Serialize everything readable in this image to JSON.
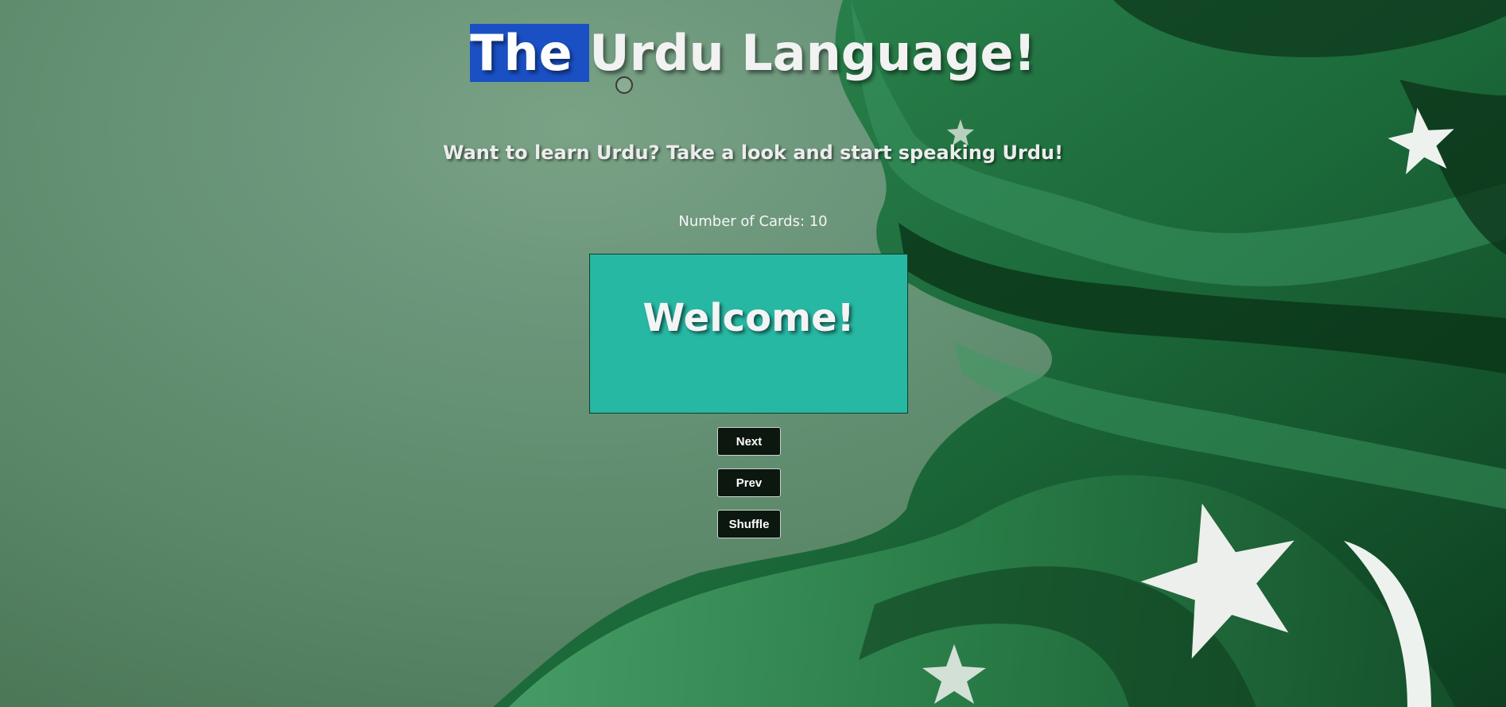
{
  "header": {
    "title_selected": "The ",
    "title_rest": "Urdu Language!",
    "subtitle": "Want to learn Urdu? Take a look and start speaking Urdu!"
  },
  "deck": {
    "count_text": "Number of Cards: 10",
    "card_text": "Welcome!"
  },
  "controls": {
    "next_label": "Next",
    "prev_label": "Prev",
    "shuffle_label": "Shuffle"
  },
  "theme": {
    "background": "#5e8a6b",
    "card_color": "#27b8a4",
    "button_color": "#0b170f",
    "selection_color": "#1a50c4",
    "flag_green": "#1d6a3a",
    "flag_dark": "#082a13"
  }
}
